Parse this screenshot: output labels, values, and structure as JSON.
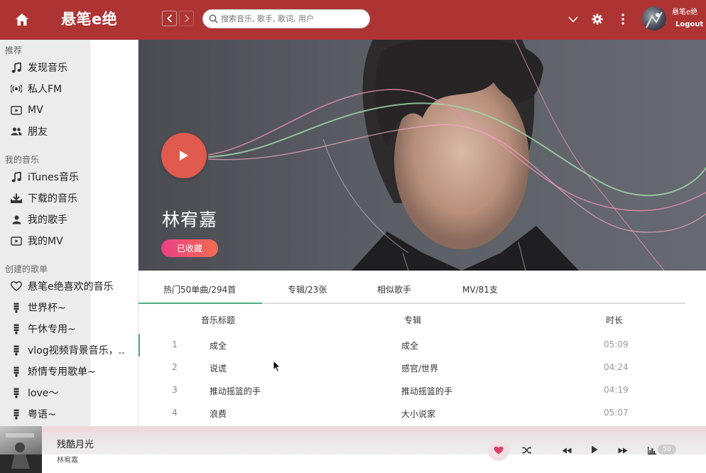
{
  "header": {
    "app_title": "悬笔e绝",
    "search_placeholder": "搜索音乐, 歌手, 歌词, 用户",
    "user_name": "悬笔e绝",
    "logout_label": "Logout"
  },
  "sidebar": {
    "sections": [
      {
        "label": "推荐",
        "items": [
          {
            "label": "发现音乐",
            "icon": "music-note-icon"
          },
          {
            "label": "私人FM",
            "icon": "radio-icon"
          },
          {
            "label": "MV",
            "icon": "video-icon"
          },
          {
            "label": "朋友",
            "icon": "friends-icon"
          }
        ]
      },
      {
        "label": "我的音乐",
        "items": [
          {
            "label": "iTunes音乐",
            "icon": "music-note-icon"
          },
          {
            "label": "下载的音乐",
            "icon": "download-icon"
          },
          {
            "label": "我的歌手",
            "icon": "person-icon"
          },
          {
            "label": "我的MV",
            "icon": "video-icon"
          }
        ]
      },
      {
        "label": "创建的歌单",
        "items": [
          {
            "label": "悬笔e绝喜欢的音乐",
            "icon": "heart-icon"
          },
          {
            "label": "世界杯~",
            "icon": "playlist-icon"
          },
          {
            "label": "午休专用~",
            "icon": "playlist-icon"
          },
          {
            "label": "vlog视频背景音乐，..",
            "icon": "playlist-icon"
          },
          {
            "label": "矫情专用歌单~",
            "icon": "playlist-icon"
          },
          {
            "label": "love～",
            "icon": "playlist-icon"
          },
          {
            "label": "粤语~",
            "icon": "playlist-icon"
          }
        ]
      }
    ]
  },
  "banner": {
    "artist_name": "林宥嘉",
    "favorite_label": "已收藏"
  },
  "tabs": [
    "热门50单曲/294首",
    "专辑/23张",
    "相似歌手",
    "MV/81支"
  ],
  "table": {
    "headers": {
      "title": "音乐标题",
      "album": "专辑",
      "duration": "时长"
    },
    "rows": [
      {
        "num": "1",
        "title": "成全",
        "album": "成全",
        "duration": "05:09"
      },
      {
        "num": "2",
        "title": "说谎",
        "album": "感官/世界",
        "duration": "04:24"
      },
      {
        "num": "3",
        "title": "推动摇篮的手",
        "album": "推动摇篮的手",
        "duration": "04:19"
      },
      {
        "num": "4",
        "title": "浪费",
        "album": "大小说家",
        "duration": "05:07"
      }
    ]
  },
  "player": {
    "song_title": "残酷月光",
    "artist": "林宥嘉",
    "volume": "50"
  },
  "colors": {
    "header": "#ae3434",
    "accent_green": "#4caf80",
    "play_button": "#e05a4f"
  }
}
